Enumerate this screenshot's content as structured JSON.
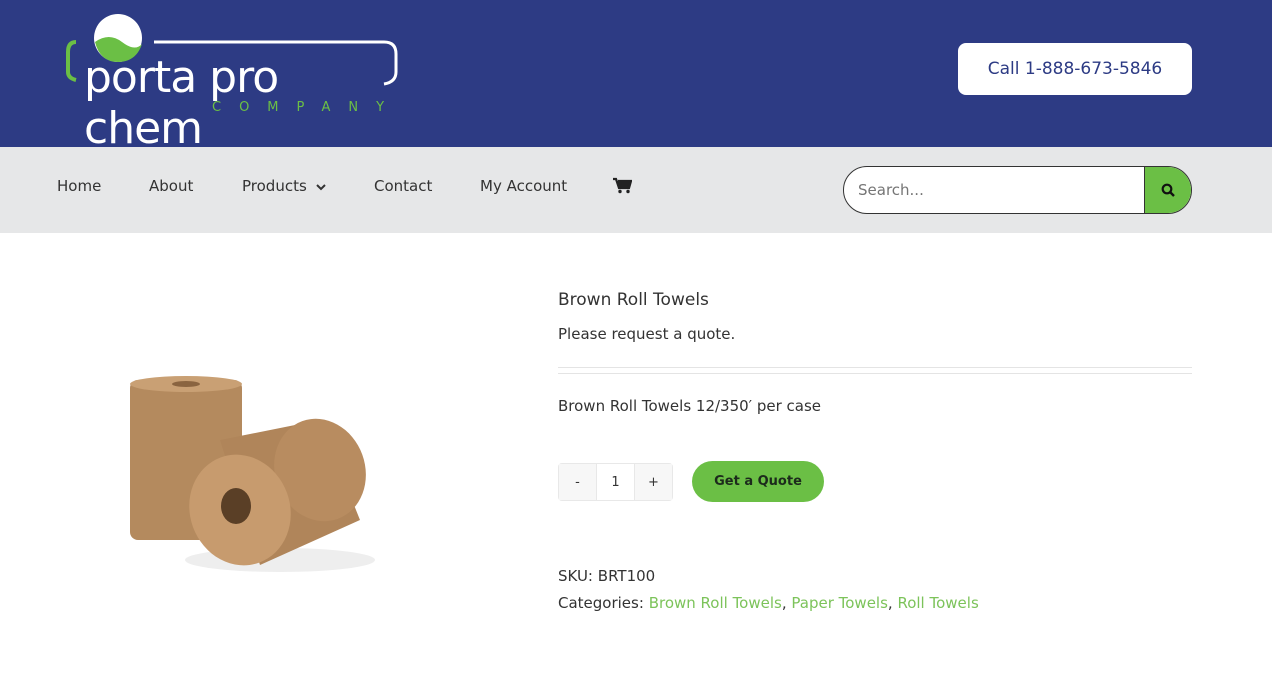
{
  "header": {
    "logo_text": "porta pro chem",
    "logo_sub": "COMPANY",
    "call_label": "Call 1-888-673-5846"
  },
  "nav": {
    "items": [
      "Home",
      "About",
      "Products",
      "Contact",
      "My Account"
    ],
    "cart_icon": "cart-icon",
    "search_placeholder": "Search..."
  },
  "product": {
    "title": "Brown Roll Towels",
    "quote_message": "Please request a quote.",
    "description": "Brown Roll Towels 12/350′ per case",
    "quantity": "1",
    "minus": "-",
    "plus": "+",
    "quote_button": "Get a Quote",
    "sku_label": "SKU:",
    "sku": "BRT100",
    "categories_label": "Categories:",
    "categories": [
      "Brown Roll Towels",
      "Paper Towels",
      "Roll Towels"
    ]
  },
  "colors": {
    "brand_blue": "#2d3b84",
    "accent_green": "#6bbf45"
  }
}
